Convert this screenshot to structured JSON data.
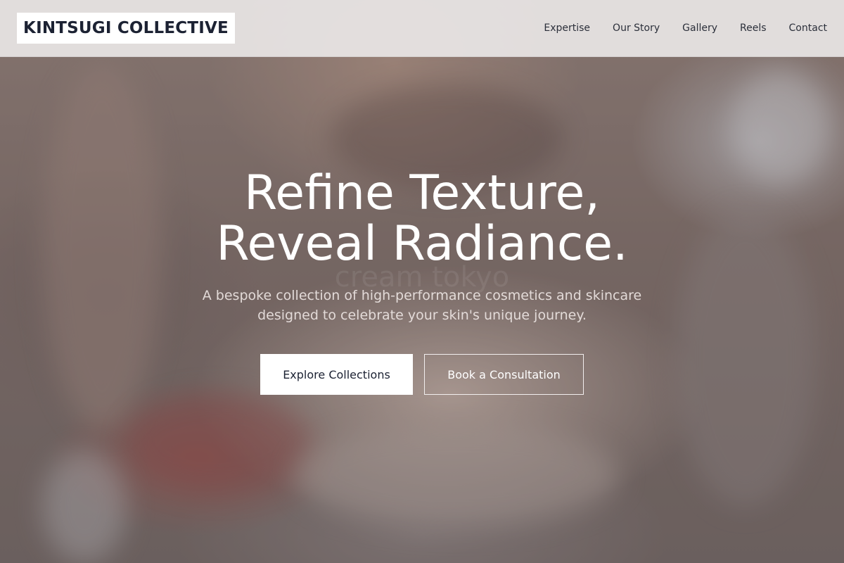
{
  "header": {
    "logo_text": "KINTSUGI COLLECTIVE",
    "nav": [
      {
        "label": "Expertise"
      },
      {
        "label": "Our Story"
      },
      {
        "label": "Gallery"
      },
      {
        "label": "Reels"
      },
      {
        "label": "Contact"
      }
    ]
  },
  "hero": {
    "title_line1": "Refine Texture,",
    "title_line2": "Reveal Radiance.",
    "watermark": "cream tokyo",
    "subtitle": "A bespoke collection of high-performance cosmetics and skincare designed to celebrate your skin's unique journey.",
    "primary_cta": "Explore Collections",
    "secondary_cta": "Book a Consultation"
  },
  "colors": {
    "logo_text": "#1c2233",
    "header_bg": "#eeecec",
    "hero_text": "#ffffff",
    "primary_button_bg": "#ffffff"
  }
}
